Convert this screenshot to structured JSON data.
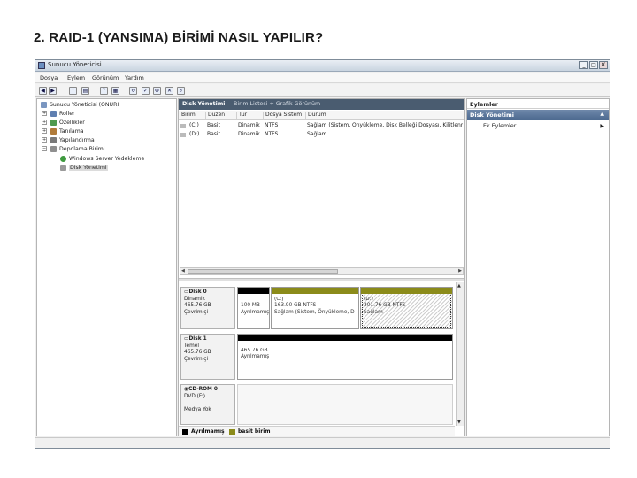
{
  "slide": {
    "title": "2. RAID-1 (YANSIMA) BİRİMİ NASIL YAPILIR?"
  },
  "window": {
    "title": "Sunucu Yöneticisi",
    "buttons": {
      "minimize": "_",
      "maximize": "□",
      "close": "X"
    }
  },
  "menu": {
    "items": [
      "Dosya",
      "Eylem",
      "Görünüm",
      "Yardım"
    ]
  },
  "tree": {
    "root": "Sunucu Yöneticisi (ONURI",
    "items": [
      "Roller",
      "Özellikler",
      "Tanılama",
      "Yapılandırma",
      "Depolama Birimi"
    ],
    "storage_children": [
      "Windows Server Yedekleme",
      "Disk Yönetimi"
    ]
  },
  "center": {
    "tab_title": "Disk Yönetimi",
    "tab_sub": "Birim Listesi + Grafik Görünüm",
    "columns": [
      "Birim",
      "Düzen",
      "Tür",
      "Dosya Sistem",
      "Durum"
    ],
    "rows": [
      {
        "name": "(C:)",
        "layout": "Basit",
        "type": "Dinamik",
        "fs": "NTFS",
        "status": "Sağlam (Sistem, Önyükleme, Disk Belleği Dosyası, Kilitlenme"
      },
      {
        "name": "(D:)",
        "layout": "Basit",
        "type": "Dinamik",
        "fs": "NTFS",
        "status": "Sağlam"
      }
    ]
  },
  "disks": [
    {
      "name": "Disk 0",
      "type": "Dinamik",
      "size": "465.76 GB",
      "state": "Çevrimiçi",
      "partitions": [
        {
          "line1": "",
          "line2": "100 MB",
          "line3": "Ayrılmamış"
        },
        {
          "line1": "(C:)",
          "line2": "163.90 GB NTFS",
          "line3": "Sağlam (Sistem, Önyükleme, D"
        },
        {
          "line1": "(D:)",
          "line2": "301.76 GB NTFS",
          "line3": "Sağlam"
        }
      ]
    },
    {
      "name": "Disk 1",
      "type": "Temel",
      "size": "465.76 GB",
      "state": "Çevrimiçi",
      "partitions": [
        {
          "line1": "465.76 GB",
          "line2": "Ayrılmamış"
        }
      ]
    },
    {
      "name": "CD-ROM 0",
      "type": "DVD (F:)",
      "size": "",
      "state": "Medya Yok"
    }
  ],
  "legend": {
    "unallocated": "Ayrılmamış",
    "simple": "basit birim"
  },
  "actions": {
    "title": "Eylemler",
    "section": "Disk Yönetimi",
    "more": "Ek Eylemler"
  },
  "colors": {
    "unallocated": "#000000",
    "simple": "#8b8b1a",
    "tab_bg": "#4a5c70",
    "action_header": "#5a7598"
  }
}
